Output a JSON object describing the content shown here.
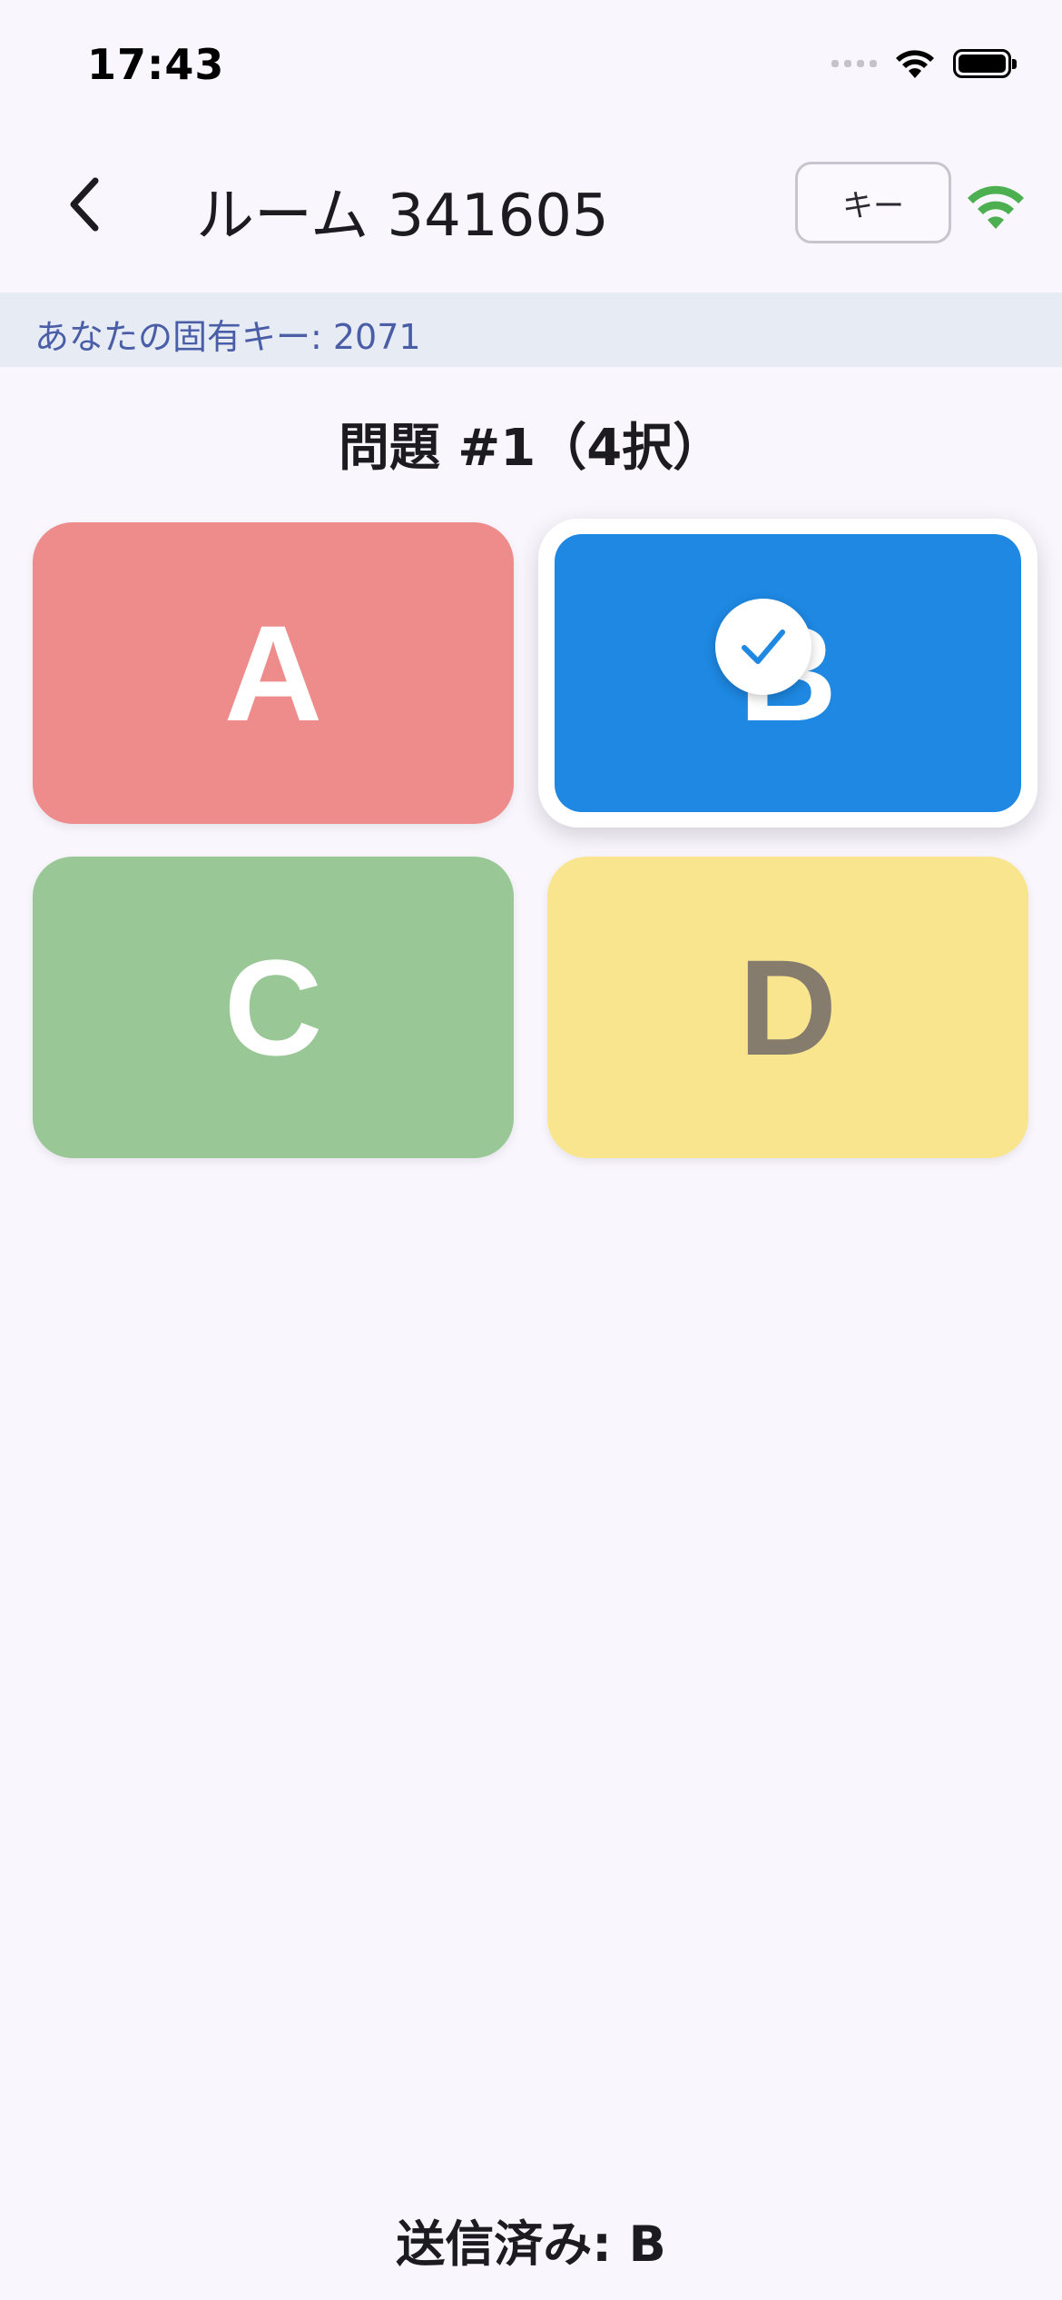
{
  "status_bar": {
    "time": "17:43",
    "icons": [
      "cellular-signal-icon",
      "wifi-icon",
      "battery-icon"
    ]
  },
  "app_bar": {
    "back_icon": "chevron-left-icon",
    "title": "ルーム 341605",
    "key_button_label": "キー",
    "connection_icon": "wifi-icon",
    "connection_color": "#4caf50"
  },
  "key_banner": {
    "text": "あなたの固有キー: 2071"
  },
  "question": {
    "heading": "問題 #1（4択）"
  },
  "choices": [
    {
      "label": "A",
      "color": "#ee8c8c",
      "selected": false
    },
    {
      "label": "B",
      "color": "#1e88e2",
      "selected": true
    },
    {
      "label": "C",
      "color": "#99c896",
      "selected": false
    },
    {
      "label": "D",
      "color": "#fae58f",
      "selected": false
    }
  ],
  "selected_icon": "check-circle-icon",
  "footer": {
    "submitted_text": "送信済み: B"
  }
}
